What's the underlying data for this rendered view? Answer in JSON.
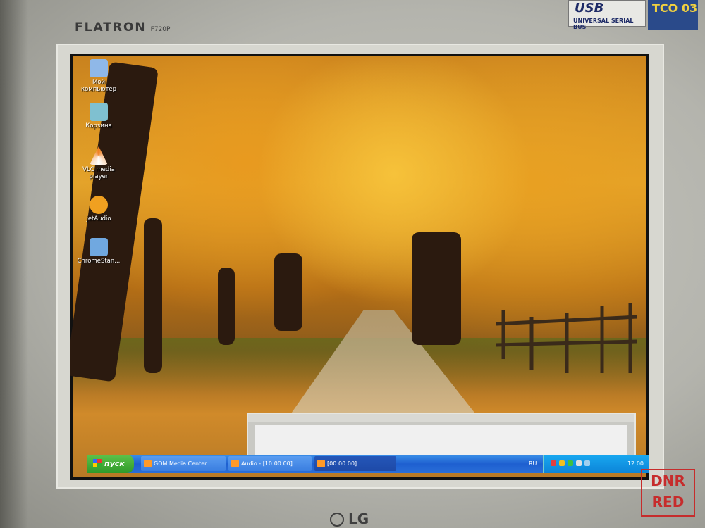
{
  "monitor": {
    "brand": "FLATRON",
    "model": "F720P",
    "usb_logo": "USB",
    "usb_label": "UNIVERSAL SERIAL BUS",
    "tco_label": "TCO 03",
    "maker": "LG"
  },
  "watermark": {
    "line1": "DNR",
    "line2": "RED"
  },
  "desktop": {
    "icons": [
      {
        "label": "Мой компьютер",
        "icon": "my-computer-icon",
        "color": "#8fb8e8"
      },
      {
        "label": "Корзина",
        "icon": "recycle-bin-icon",
        "color": "#7fc0d0"
      },
      {
        "label": "VLC media player",
        "icon": "vlc-icon",
        "color": "#f08020"
      },
      {
        "label": "jetAudio",
        "icon": "jetaudio-icon",
        "color": "#f0a020"
      },
      {
        "label": "ChromeStan...",
        "icon": "chrome-standalone-icon",
        "color": "#70a8e0"
      }
    ]
  },
  "window": {
    "title": ""
  },
  "taskbar": {
    "start_label": "пуск",
    "tasks": [
      {
        "label": "GOM Media Center"
      },
      {
        "label": "Audio - [10:00:00]..."
      },
      {
        "label": "[00:00:00] ..."
      }
    ],
    "language": "RU",
    "clock": "12:00"
  }
}
